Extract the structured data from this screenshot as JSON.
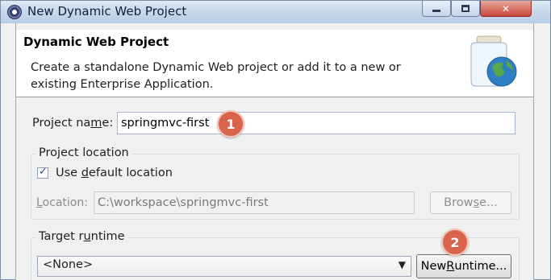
{
  "window": {
    "title": "New Dynamic Web Project",
    "buttons": {
      "minimize": "minimize",
      "maximize": "maximize",
      "close": "close"
    }
  },
  "banner": {
    "title": "Dynamic Web Project",
    "description": "Create a standalone Dynamic Web project or add it to a new or existing Enterprise Application."
  },
  "project_name": {
    "label_pre": "Project na",
    "label_accel": "m",
    "label_post": "e:",
    "value": "springmvc-first"
  },
  "project_location": {
    "legend": "Project location",
    "use_default": {
      "label_pre": "Use ",
      "label_accel": "d",
      "label_post": "efault location",
      "checked": true
    },
    "location_label_accel": "L",
    "location_label_post": "ocation:",
    "location_value": "C:\\workspace\\springmvc-first",
    "browse_pre": "Brow",
    "browse_accel": "s",
    "browse_post": "e..."
  },
  "target_runtime": {
    "legend_pre": "Target r",
    "legend_accel": "u",
    "legend_post": "ntime",
    "selected": "<None>",
    "new_runtime_pre": "New ",
    "new_runtime_accel": "R",
    "new_runtime_post": "untime..."
  },
  "annotations": {
    "badge_1": "1",
    "badge_2": "2"
  },
  "colors": {
    "badge": "#d9634d",
    "titlebar": "#c8d9ee",
    "close_button": "#c7463a"
  },
  "icons": {
    "app": "eclipse-icon",
    "banner": "jar-globe-icon",
    "dropdown": "chevron-down-icon",
    "check": "checkmark-icon"
  }
}
